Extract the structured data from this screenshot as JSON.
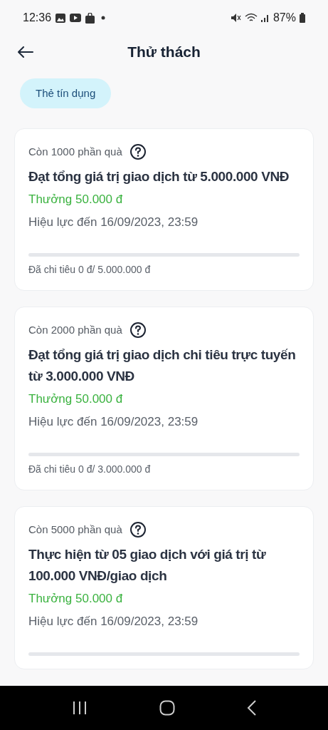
{
  "status_bar": {
    "time": "12:36",
    "battery": "87%"
  },
  "header": {
    "title": "Thử thách"
  },
  "filters": [
    {
      "label": "Thẻ tín dụng",
      "selected": true
    }
  ],
  "challenges": [
    {
      "remaining": "Còn 1000 phần quà",
      "title": "Đạt tổng giá trị giao dịch từ 5.000.000 VNĐ",
      "reward": "Thưởng 50.000 đ",
      "validity": "Hiệu lực đến 16/09/2023, 23:59",
      "level": 0,
      "spent": "Đã chi tiêu 0 đ/ 5.000.000 đ"
    },
    {
      "remaining": "Còn 2000 phần quà",
      "title": "Đạt tổng giá trị giao dịch chi tiêu trực tuyến từ 3.000.000 VNĐ",
      "reward": "Thưởng 50.000 đ",
      "validity": "Hiệu lực đến 16/09/2023, 23:59",
      "level": 0,
      "spent": "Đã chi tiêu 0 đ/ 3.000.000 đ"
    },
    {
      "remaining": "Còn 5000 phần quà",
      "title": "Thực hiện từ 05 giao dịch với giá trị từ 100.000 VNĐ/giao dịch",
      "reward": "Thưởng 50.000 đ",
      "validity": "Hiệu lực đến 16/09/2023, 23:59",
      "level": 0
    }
  ]
}
